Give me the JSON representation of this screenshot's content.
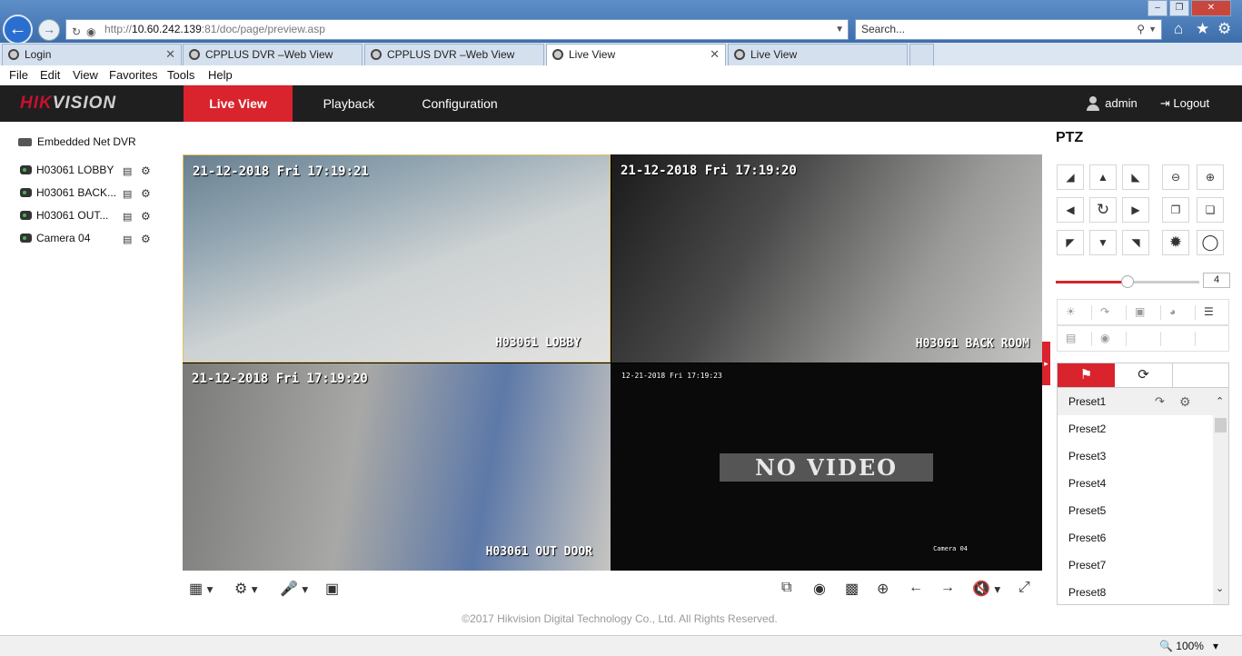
{
  "browser": {
    "address_prefix": "http://",
    "address_host": "10.60.242.139",
    "address_rest": ":81/doc/page/preview.asp",
    "search_placeholder": "Search...",
    "tabs": [
      {
        "label": "Login",
        "active": false
      },
      {
        "label": "CPPLUS DVR –Web View",
        "active": false
      },
      {
        "label": "CPPLUS DVR –Web View",
        "active": false
      },
      {
        "label": "Live View",
        "active": true
      },
      {
        "label": "Live View",
        "active": false
      }
    ],
    "menu": [
      "File",
      "Edit",
      "View",
      "Favorites",
      "Tools",
      "Help"
    ],
    "zoom": "100%"
  },
  "app": {
    "logo_accent": "HIK",
    "logo_rest": "VISION",
    "nav": [
      "Live View",
      "Playback",
      "Configuration"
    ],
    "user": "admin",
    "logout": "Logout"
  },
  "devices": {
    "root": "Embedded Net DVR",
    "cameras": [
      "H03061 LOBBY",
      "H03061 BACK...",
      "H03061 OUT...",
      "Camera 04"
    ]
  },
  "video": {
    "cells": [
      {
        "timestamp": "21-12-2018 Fri 17:19:21",
        "name": "H03061 LOBBY"
      },
      {
        "timestamp": "21-12-2018 Fri 17:19:20",
        "name": "H03061 BACK ROOM"
      },
      {
        "timestamp": "21-12-2018 Fri 17:19:20",
        "name": "H03061 OUT DOOR"
      },
      {
        "timestamp": "12-21-2018 Fri 17:19:23",
        "name": "Camera 04",
        "overlay": "NO VIDEO"
      }
    ]
  },
  "ptz": {
    "title": "PTZ",
    "speed": "4",
    "speed_fraction": 0.5,
    "presets": [
      "Preset1",
      "Preset2",
      "Preset3",
      "Preset4",
      "Preset5",
      "Preset6",
      "Preset7",
      "Preset8"
    ]
  },
  "footer": {
    "copyright": "©2017 Hikvision Digital Technology Co., Ltd. All Rights Reserved."
  },
  "colors": {
    "accent": "#d9232d",
    "nav_bg": "#1f1f1f",
    "selected_border": "#e5c15a"
  }
}
